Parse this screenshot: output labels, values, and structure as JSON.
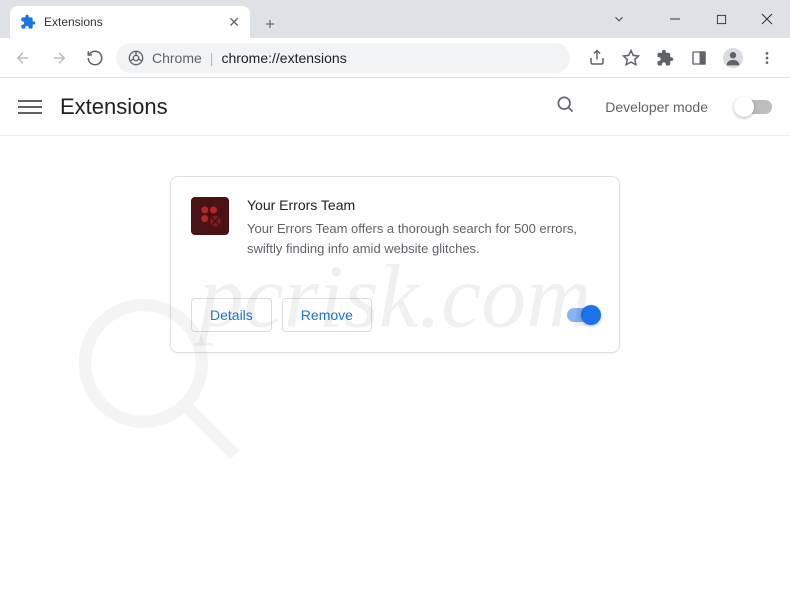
{
  "window": {
    "tab_title": "Extensions"
  },
  "addressbar": {
    "prefix": "Chrome",
    "url": "chrome://extensions"
  },
  "header": {
    "title": "Extensions",
    "developer_mode_label": "Developer mode"
  },
  "extension": {
    "name": "Your Errors Team",
    "description": "Your Errors Team offers a thorough search for 500 errors, swiftly finding info amid website glitches.",
    "details_label": "Details",
    "remove_label": "Remove",
    "enabled": true
  },
  "watermark": "pcrisk.com"
}
